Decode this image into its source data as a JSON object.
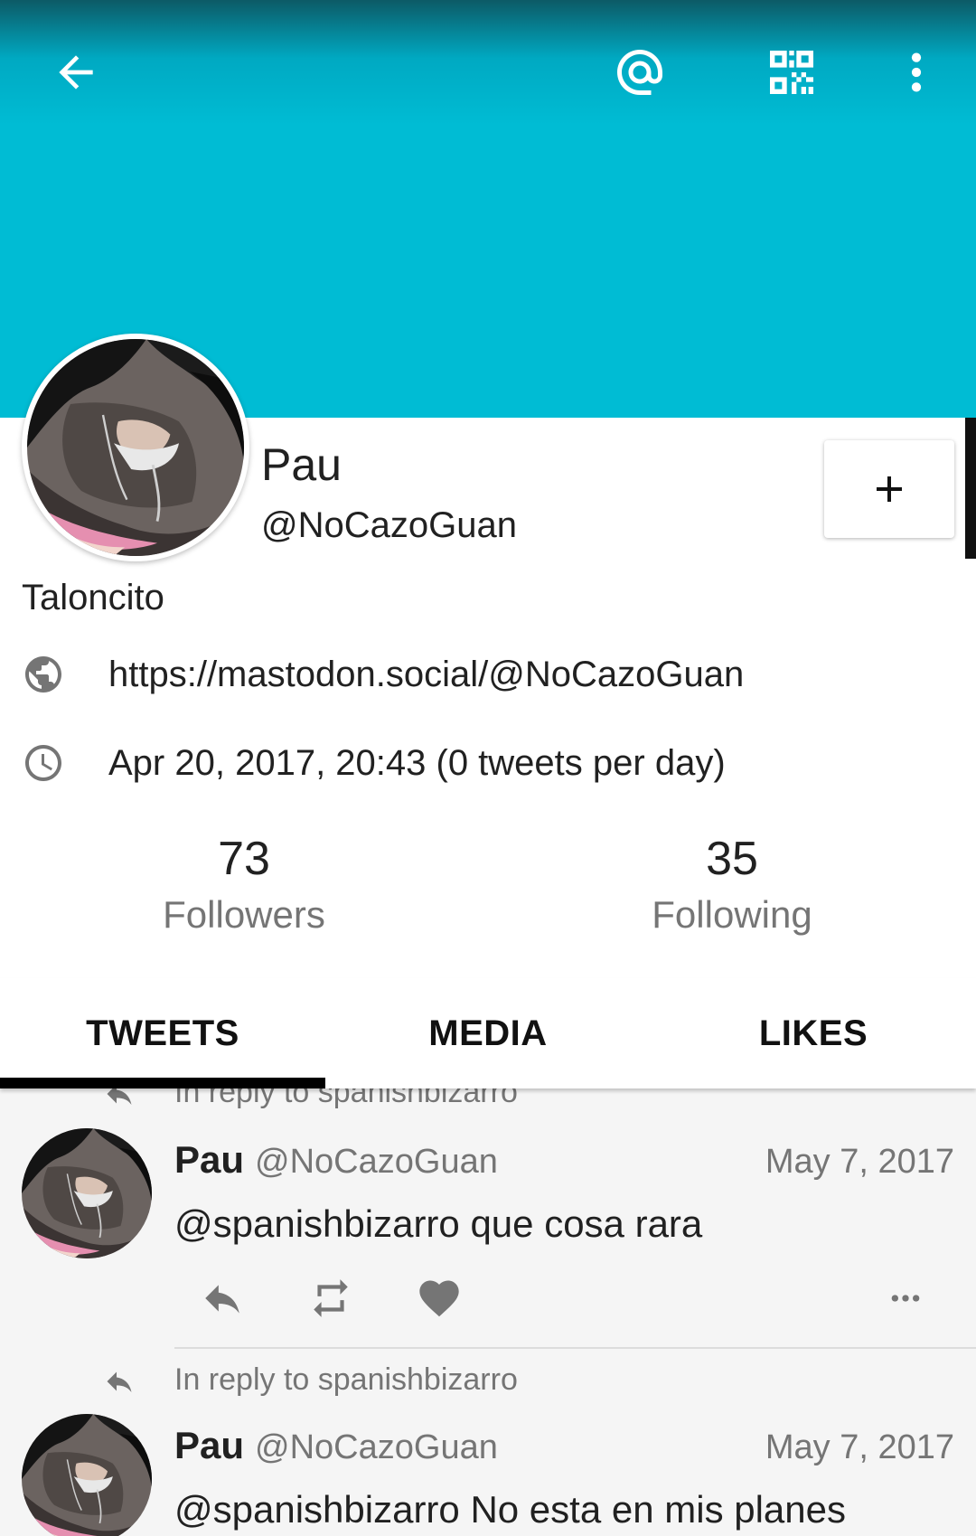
{
  "topbar": {
    "back_icon": "arrow-left-icon",
    "mention_icon": "at-sign-icon",
    "qr_icon": "qr-code-icon",
    "more_icon": "more-vertical-icon"
  },
  "colors": {
    "banner": "#00bcd4",
    "text_primary": "#212121",
    "text_secondary": "#757575"
  },
  "profile": {
    "display_name": "Pau",
    "handle": "@NoCazoGuan",
    "bio": "Taloncito",
    "url": "https://mastodon.social/@NoCazoGuan",
    "joined": "Apr 20, 2017, 20:43 (0 tweets per day)",
    "follow_button_label": "+",
    "stats": {
      "followers_count": "73",
      "followers_label": "Followers",
      "following_count": "35",
      "following_label": "Following"
    }
  },
  "tabs": [
    {
      "label": "TWEETS",
      "active": true
    },
    {
      "label": "MEDIA",
      "active": false
    },
    {
      "label": "LIKES",
      "active": false
    }
  ],
  "timeline": {
    "top_partial_reply": "In reply to spanishbizarro",
    "tweets": [
      {
        "name": "Pau",
        "handle": "@NoCazoGuan",
        "date": "May 7, 2017",
        "text": "@spanishbizarro que cosa rara"
      },
      {
        "reply_to": "In reply to spanishbizarro",
        "name": "Pau",
        "handle": "@NoCazoGuan",
        "date": "May 7, 2017",
        "text": "@spanishbizarro No esta en mis planes"
      }
    ]
  }
}
